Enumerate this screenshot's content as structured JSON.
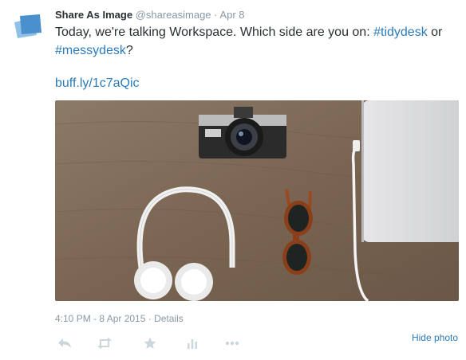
{
  "tweet": {
    "author_name": "Share As Image",
    "handle": "@shareasimage",
    "separator": "·",
    "date": "Apr 8",
    "text_before": "Today, we're talking Workspace. Which side are you on: ",
    "hashtag1": "#tidydesk",
    "text_mid": " or ",
    "hashtag2": "#messydesk",
    "text_after": "?",
    "link": "buff.ly/1c7aQic",
    "timestamp": "4:10 PM - 8 Apr 2015",
    "details_sep": " · ",
    "details": "Details",
    "hide_photo": "Hide photo"
  },
  "actions": [
    {
      "icon": "reply-icon"
    },
    {
      "icon": "retweet-icon"
    },
    {
      "icon": "favorite-star-icon"
    },
    {
      "icon": "analytics-icon"
    },
    {
      "icon": "more-icon"
    }
  ],
  "colors": {
    "link": "#2b7bb9",
    "muted": "#8899a6",
    "action_icon": "#ccd6dd",
    "avatar": "#5b9bd5"
  }
}
